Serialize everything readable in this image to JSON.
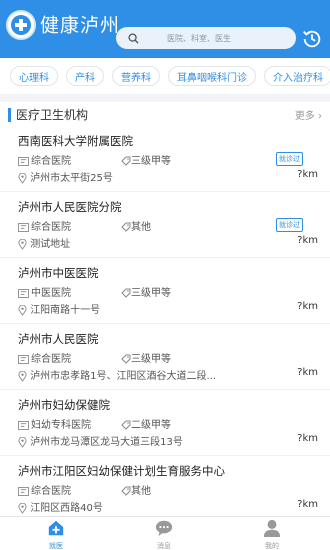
{
  "header": {
    "title": "健康泸州",
    "search_placeholder": "医院、科室、医生",
    "logo_icon": "health-cross-logo",
    "history_icon": "history-icon"
  },
  "tags": [
    "心理科",
    "产科",
    "营养科",
    "耳鼻咽喉科门诊",
    "介入治疗科"
  ],
  "section": {
    "title": "医疗卫生机构",
    "more": "更多"
  },
  "hospitals": [
    {
      "name": "西南医科大学附属医院",
      "type": "综合医院",
      "level": "三级甲等",
      "badge": "就诊过",
      "address": "泸州市太平街25号",
      "distance": "?km"
    },
    {
      "name": "泸州市人民医院分院",
      "type": "综合医院",
      "level": "其他",
      "badge": "就诊过",
      "address": "测试地址",
      "distance": "?km"
    },
    {
      "name": "泸州市中医医院",
      "type": "中医医院",
      "level": "三级甲等",
      "badge": "",
      "address": "江阳南路十一号",
      "distance": "?km"
    },
    {
      "name": "泸州市人民医院",
      "type": "综合医院",
      "level": "三级甲等",
      "badge": "",
      "address": "泸州市忠孝路1号、江阳区酒谷大道二段...",
      "distance": "?km"
    },
    {
      "name": "泸州市妇幼保健院",
      "type": "妇幼专科医院",
      "level": "二级甲等",
      "badge": "",
      "address": "泸州市龙马潭区龙马大道三段13号",
      "distance": "?km"
    },
    {
      "name": "泸州市江阳区妇幼保健计划生育服务中心",
      "type": "综合医院",
      "level": "其他",
      "badge": "",
      "address": "江阳区西路40号",
      "distance": "?km"
    }
  ],
  "nav": [
    {
      "label": "就医",
      "icon": "home-plus-icon",
      "active": true
    },
    {
      "label": "消息",
      "icon": "chat-bubble-icon",
      "active": false
    },
    {
      "label": "我的",
      "icon": "person-icon",
      "active": false
    }
  ],
  "colors": {
    "primary": "#2f8fe6",
    "background": "#f2f4f7"
  }
}
